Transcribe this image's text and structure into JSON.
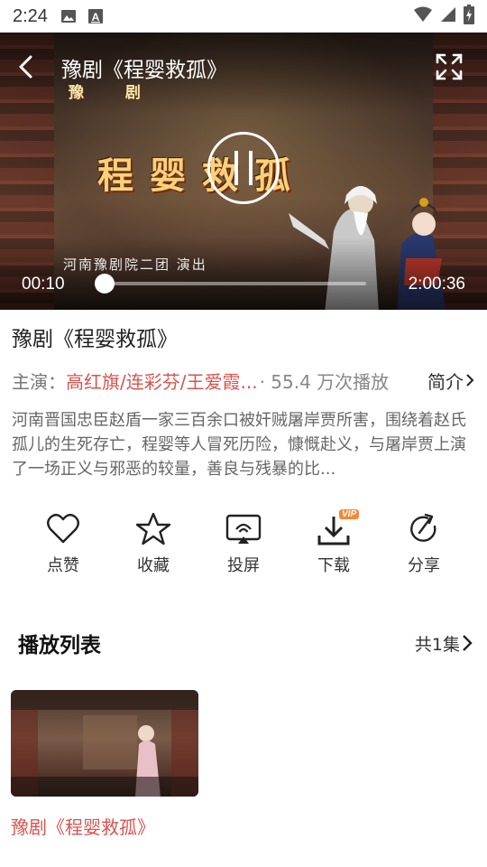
{
  "status_bar": {
    "time": "2:24",
    "icons": [
      "image-icon",
      "a-notification-icon",
      "wifi-icon",
      "signal-icon",
      "battery-charging-icon"
    ]
  },
  "player": {
    "title": "豫剧《程婴救孤》",
    "overlay_category": "豫 剧",
    "overlay_title": "程婴救孤",
    "overlay_troupe": "河南豫剧院二团 演出",
    "current_time": "00:10",
    "total_time": "2:00:36",
    "progress_fraction": 0.0014,
    "state": "paused"
  },
  "info": {
    "title": "豫剧《程婴救孤》",
    "cast_label": "主演：",
    "cast_names": "高红旗/连彩芬/王爱霞...",
    "play_count": "· 55.4 万次播放",
    "intro_label": "简介",
    "description": "河南晋国忠臣赵盾一家三百余口被奸贼屠岸贾所害，围绕着赵氏孤儿的生死存亡，程婴等人冒死历险，慷慨赴义，与屠岸贾上演了一场正义与邪恶的较量，善良与残暴的比..."
  },
  "actions": [
    {
      "label": "点赞",
      "icon": "heart-icon"
    },
    {
      "label": "收藏",
      "icon": "star-icon"
    },
    {
      "label": "投屏",
      "icon": "cast-screen-icon"
    },
    {
      "label": "下载",
      "icon": "download-icon",
      "badge": "VIP"
    },
    {
      "label": "分享",
      "icon": "share-icon"
    }
  ],
  "playlist": {
    "title": "播放列表",
    "count_label": "共1集",
    "episodes": [
      {
        "title": "豫剧《程婴救孤》"
      }
    ]
  },
  "colors": {
    "accent_red": "#d9534f",
    "vip_orange": "#f08a3c",
    "title_gold": "#f6d27a"
  }
}
